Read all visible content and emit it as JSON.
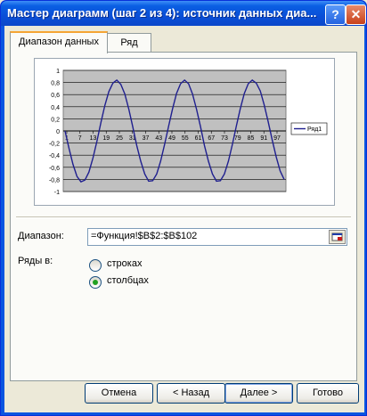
{
  "window": {
    "title": "Мастер диаграмм (шаг 2 из 4): источник данных диа...",
    "help_glyph": "?",
    "close_glyph": "✕"
  },
  "tabs": [
    {
      "label": "Диапазон данных",
      "active": true
    },
    {
      "label": "Ряд",
      "active": false
    }
  ],
  "chart_data": {
    "type": "line",
    "series": [
      {
        "name": "Ряд1",
        "color": "#1f1f8f",
        "values": [
          0.0,
          -0.29,
          -0.55,
          -0.75,
          -0.84,
          -0.81,
          -0.68,
          -0.45,
          -0.17,
          0.14,
          0.42,
          0.65,
          0.79,
          0.84,
          0.77,
          0.61,
          0.36,
          0.07,
          -0.24,
          -0.5,
          -0.71,
          -0.83,
          -0.82,
          -0.71,
          -0.5,
          -0.22,
          0.08,
          0.37,
          0.62,
          0.78,
          0.84,
          0.78,
          0.61,
          0.36,
          0.07,
          -0.24,
          -0.5,
          -0.71,
          -0.83,
          -0.82,
          -0.71,
          -0.5,
          -0.22,
          0.08,
          0.37,
          0.62,
          0.78,
          0.84,
          0.79,
          0.66,
          0.43,
          0.15,
          -0.15,
          -0.43,
          -0.66,
          -0.8
        ]
      }
    ],
    "x_tick_labels": [
      "1",
      "7",
      "13",
      "19",
      "25",
      "31",
      "37",
      "43",
      "49",
      "55",
      "61",
      "67",
      "73",
      "79",
      "85",
      "91",
      "97"
    ],
    "y_tick_labels": [
      "1",
      "0,8",
      "0,6",
      "0,4",
      "0,2",
      "0",
      "-0,2",
      "-0,4",
      "-0,6",
      "-0,8",
      "-1"
    ],
    "ylim": [
      -1,
      1
    ],
    "grid": true,
    "legend_position": "right",
    "plot_background": "#c0c0c0"
  },
  "form": {
    "range_label": "Диапазон:",
    "range_value": "=Функция!$B$2:$B$102",
    "series_in_label": "Ряды в:",
    "options": [
      {
        "label": "строках",
        "selected": false
      },
      {
        "label": "столбцах",
        "selected": true
      }
    ]
  },
  "buttons": {
    "cancel": "Отмена",
    "back": "< Назад",
    "next": "Далее >",
    "finish": "Готово"
  }
}
